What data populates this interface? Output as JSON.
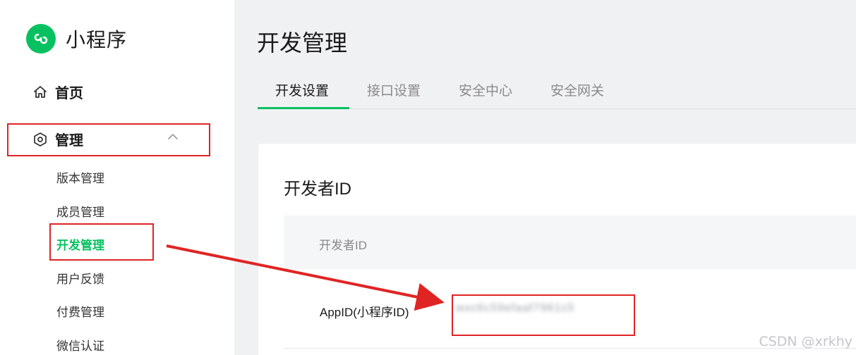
{
  "brand": {
    "name": "小程序",
    "logo_icon": "miniprogram-logo-icon",
    "accent": "#07c160"
  },
  "sidebar": {
    "home": {
      "label": "首页",
      "icon": "home-icon"
    },
    "group": {
      "label": "管理",
      "icon": "hexagon-settings-icon",
      "expanded": true,
      "items": [
        {
          "label": "版本管理",
          "active": false
        },
        {
          "label": "成员管理",
          "active": false
        },
        {
          "label": "开发管理",
          "active": true
        },
        {
          "label": "用户反馈",
          "active": false
        },
        {
          "label": "付费管理",
          "active": false
        },
        {
          "label": "微信认证",
          "active": false
        }
      ]
    }
  },
  "main": {
    "title": "开发管理",
    "tabs": [
      {
        "label": "开发设置",
        "active": true
      },
      {
        "label": "接口设置",
        "active": false
      },
      {
        "label": "安全中心",
        "active": false
      },
      {
        "label": "安全网关",
        "active": false
      }
    ],
    "card": {
      "title": "开发者ID",
      "table_header": "开发者ID",
      "row_label": "AppID(小程序ID)",
      "row_value": "wxc6c59efaaf7961c5"
    }
  },
  "annotations": {
    "color": "#e02424"
  },
  "watermark": "CSDN @xrkhy"
}
